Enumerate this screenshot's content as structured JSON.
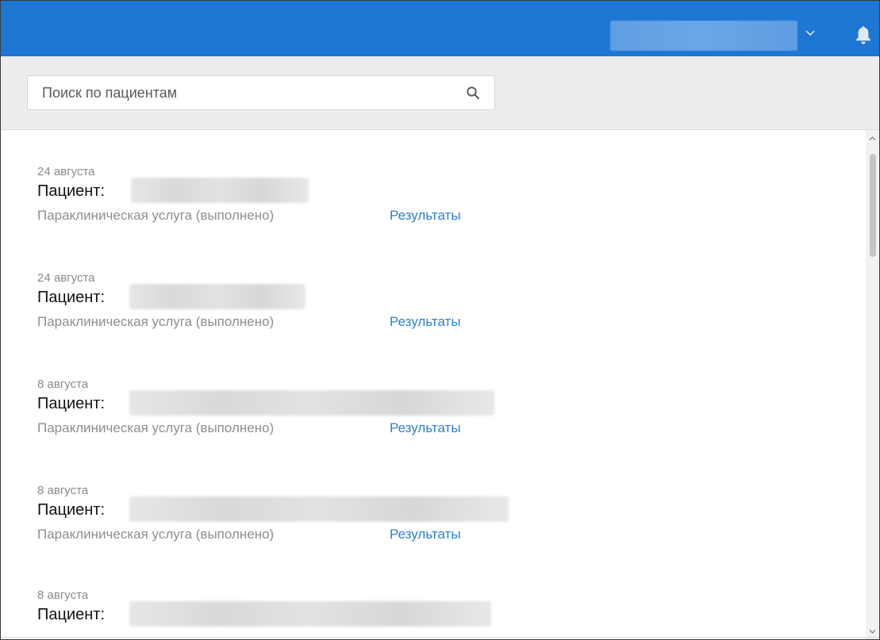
{
  "header": {
    "user_selector_value": "",
    "accent_color": "#1d76d2",
    "icons": [
      "chevron-down-icon",
      "bell-icon"
    ]
  },
  "search": {
    "placeholder": "Поиск по пациентам",
    "value": "",
    "icon": "search-icon"
  },
  "list": {
    "items": [
      {
        "date": "24 августа",
        "patient_label": "Пациент:",
        "patient_name": "",
        "service": "Параклиническая услуга (выполнено)",
        "results_link": "Результаты"
      },
      {
        "date": "24 августа",
        "patient_label": "Пациент:",
        "patient_name": "",
        "service": "Параклиническая услуга (выполнено)",
        "results_link": "Результаты"
      },
      {
        "date": "8 августа",
        "patient_label": "Пациент:",
        "patient_name": "",
        "service": "Параклиническая услуга (выполнено)",
        "results_link": "Результаты"
      },
      {
        "date": "8 августа",
        "patient_label": "Пациент:",
        "patient_name": "",
        "service": "Параклиническая услуга (выполнено)",
        "results_link": "Результаты"
      },
      {
        "date": "8 августа",
        "patient_label": "Пациент:",
        "patient_name": ""
      }
    ]
  },
  "colors": {
    "link": "#2a7fd4",
    "muted_text": "#8e8e8e",
    "search_band": "#ededed"
  }
}
